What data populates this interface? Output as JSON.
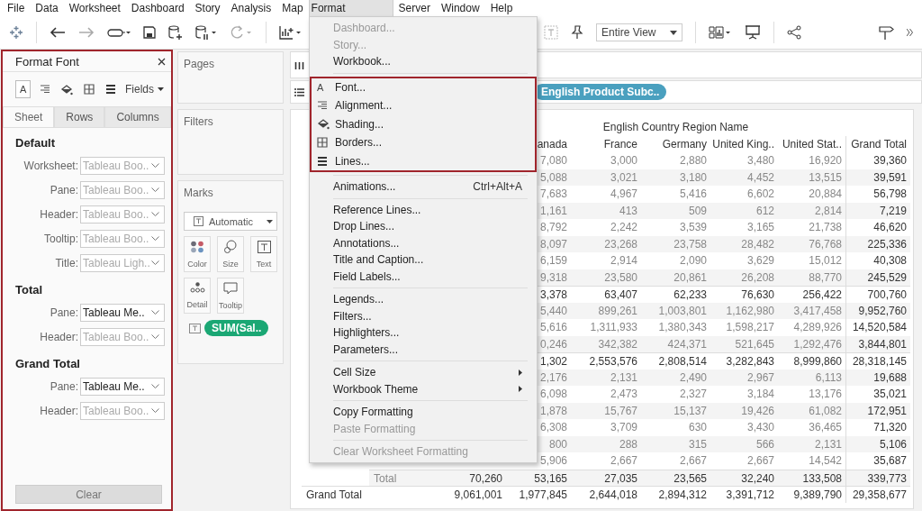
{
  "menu_bar": [
    {
      "label": "File",
      "selected": false
    },
    {
      "label": "Data",
      "selected": false
    },
    {
      "label": "Worksheet",
      "selected": false
    },
    {
      "label": "Dashboard",
      "selected": false
    },
    {
      "label": "Story",
      "selected": false
    },
    {
      "label": "Analysis",
      "selected": false
    },
    {
      "label": "Map",
      "selected": false
    },
    {
      "label": "Format",
      "selected": true
    },
    {
      "label": "Server",
      "selected": false
    },
    {
      "label": "Window",
      "selected": false
    },
    {
      "label": "Help",
      "selected": false
    }
  ],
  "toolbar": {
    "view_dropdown": "Entire View"
  },
  "format_panel": {
    "title": "Format Font",
    "icon_tabs": [
      {
        "kind": "font",
        "glyph": "A",
        "selected": true
      },
      {
        "kind": "alignment",
        "selected": false
      },
      {
        "kind": "shading",
        "selected": false
      },
      {
        "kind": "borders",
        "selected": false
      },
      {
        "kind": "lines",
        "selected": false
      }
    ],
    "fields_menu": "Fields",
    "tabs": [
      {
        "label": "Sheet",
        "selected": true
      },
      {
        "label": "Rows",
        "selected": false
      },
      {
        "label": "Columns",
        "selected": false
      }
    ],
    "sections": [
      {
        "title": "Default",
        "fields": [
          {
            "label": "Worksheet:",
            "value": "Tableau Boo..",
            "dimmed": true
          },
          {
            "label": "Pane:",
            "value": "Tableau Boo..",
            "dimmed": true
          },
          {
            "label": "Header:",
            "value": "Tableau Boo..",
            "dimmed": true
          },
          {
            "label": "Tooltip:",
            "value": "Tableau Boo..",
            "dimmed": true
          },
          {
            "label": "Title:",
            "value": "Tableau Ligh..",
            "dimmed": true
          }
        ]
      },
      {
        "title": "Total",
        "fields": [
          {
            "label": "Pane:",
            "value": "Tableau Me..",
            "dimmed": false
          },
          {
            "label": "Header:",
            "value": "Tableau Boo..",
            "dimmed": true
          }
        ]
      },
      {
        "title": "Grand Total",
        "fields": [
          {
            "label": "Pane:",
            "value": "Tableau Me..",
            "dimmed": false
          },
          {
            "label": "Header:",
            "value": "Tableau Boo..",
            "dimmed": true
          }
        ]
      }
    ],
    "clear_button": {
      "label": "Clear",
      "disabled": true
    }
  },
  "cards": {
    "pages": "Pages",
    "filters": "Filters",
    "marks": {
      "title": "Marks",
      "mark_type": "Automatic",
      "buttons": [
        {
          "kind": "color",
          "label": "Color"
        },
        {
          "kind": "size",
          "label": "Size"
        },
        {
          "kind": "text",
          "label": "Text"
        },
        {
          "kind": "detail",
          "label": "Detail"
        },
        {
          "kind": "tooltip",
          "label": "Tooltip"
        }
      ],
      "pill": "SUM(Sal.."
    }
  },
  "shelves": {
    "rows_pill": "English Product Subc.."
  },
  "table": {
    "group_header": "English Country Region Name",
    "columns": [
      null,
      "anada",
      "France",
      "Germany",
      "United King..",
      "United Stat..",
      "Grand Total"
    ],
    "rows": [
      {
        "kind": "detail",
        "cells": [
          null,
          "7,080",
          "3,000",
          "2,880",
          "3,480",
          "16,920",
          "39,360"
        ]
      },
      {
        "kind": "detail",
        "cells": [
          null,
          "5,088",
          "3,021",
          "3,180",
          "4,452",
          "13,515",
          "39,591"
        ]
      },
      {
        "kind": "detail",
        "cells": [
          null,
          "7,683",
          "4,967",
          "5,416",
          "6,602",
          "20,884",
          "56,798"
        ]
      },
      {
        "kind": "detail",
        "cells": [
          null,
          "1,161",
          "413",
          "509",
          "612",
          "2,814",
          "7,219"
        ]
      },
      {
        "kind": "detail",
        "cells": [
          null,
          "8,792",
          "2,242",
          "3,539",
          "3,165",
          "21,738",
          "46,620"
        ]
      },
      {
        "kind": "detail",
        "cells": [
          null,
          "8,097",
          "23,268",
          "23,758",
          "28,482",
          "76,768",
          "225,336"
        ]
      },
      {
        "kind": "detail",
        "cells": [
          null,
          "6,159",
          "2,914",
          "2,090",
          "3,629",
          "15,012",
          "40,308"
        ]
      },
      {
        "kind": "detail",
        "cells": [
          null,
          "9,318",
          "23,580",
          "20,861",
          "26,208",
          "88,770",
          "245,529"
        ]
      },
      {
        "kind": "subtotal",
        "cells": [
          null,
          "3,378",
          "63,407",
          "62,233",
          "76,630",
          "256,422",
          "700,760"
        ]
      },
      {
        "kind": "detail",
        "cells": [
          null,
          "5,440",
          "899,261",
          "1,003,801",
          "1,162,980",
          "3,417,458",
          "9,952,760"
        ]
      },
      {
        "kind": "detail",
        "cells": [
          null,
          "5,616",
          "1,311,933",
          "1,380,343",
          "1,598,217",
          "4,289,926",
          "14,520,584"
        ]
      },
      {
        "kind": "detail",
        "cells": [
          null,
          "0,246",
          "342,382",
          "424,371",
          "521,645",
          "1,292,476",
          "3,844,801"
        ]
      },
      {
        "kind": "subtotal",
        "cells": [
          null,
          "1,302",
          "2,553,576",
          "2,808,514",
          "3,282,843",
          "8,999,860",
          "28,318,145"
        ]
      },
      {
        "kind": "detail",
        "cells": [
          null,
          "2,176",
          "2,131",
          "2,490",
          "2,967",
          "6,113",
          "19,688"
        ]
      },
      {
        "kind": "detail",
        "cells": [
          null,
          "6,098",
          "2,473",
          "2,327",
          "3,184",
          "13,176",
          "35,021"
        ]
      },
      {
        "kind": "detail",
        "cells": [
          null,
          "1,878",
          "15,767",
          "15,137",
          "19,426",
          "61,082",
          "172,951"
        ]
      },
      {
        "kind": "detail",
        "cells": [
          null,
          "6,308",
          "3,709",
          "630",
          "3,430",
          "36,465",
          "71,320"
        ]
      },
      {
        "kind": "detail",
        "cells": [
          null,
          "800",
          "288",
          "315",
          "566",
          "2,131",
          "5,106"
        ]
      },
      {
        "kind": "detail",
        "cells": [
          null,
          "5,906",
          "2,667",
          "2,667",
          "2,667",
          "14,542",
          "35,687"
        ]
      },
      {
        "kind": "subtotal",
        "label": "Total",
        "cells": [
          "70,260",
          "53,165",
          "27,035",
          "23,565",
          "32,240",
          "133,508",
          "339,773"
        ]
      },
      {
        "kind": "grand",
        "label": "Grand Total",
        "cells": [
          "9,061,001",
          "1,977,845",
          "2,644,018",
          "2,894,312",
          "3,391,712",
          "9,389,790",
          "29,358,677"
        ]
      }
    ]
  },
  "format_menu": {
    "sections": [
      {
        "highlighted": false,
        "items": [
          {
            "kind": "plain",
            "label": "Dashboard...",
            "disabled": true
          },
          {
            "kind": "plain",
            "label": "Story...",
            "disabled": true
          },
          {
            "kind": "plain",
            "label": "Workbook...",
            "disabled": false
          }
        ]
      },
      {
        "highlighted": true,
        "items": [
          {
            "kind": "font",
            "glyph": "A",
            "label": "Font...",
            "disabled": false
          },
          {
            "kind": "alignment",
            "label": "Alignment...",
            "disabled": false
          },
          {
            "kind": "shading",
            "label": "Shading...",
            "disabled": false
          },
          {
            "kind": "borders",
            "label": "Borders...",
            "disabled": false
          },
          {
            "kind": "lines",
            "label": "Lines...",
            "disabled": false
          }
        ]
      },
      {
        "highlighted": false,
        "items": [
          {
            "kind": "plain",
            "label": "Animations...",
            "shortcut": "Ctrl+Alt+A",
            "disabled": false
          }
        ]
      },
      {
        "highlighted": false,
        "items": [
          {
            "kind": "plain",
            "label": "Reference Lines...",
            "disabled": false
          },
          {
            "kind": "plain",
            "label": "Drop Lines...",
            "disabled": false
          },
          {
            "kind": "plain",
            "label": "Annotations...",
            "disabled": false
          },
          {
            "kind": "plain",
            "label": "Title and Caption...",
            "disabled": false
          },
          {
            "kind": "plain",
            "label": "Field Labels...",
            "disabled": false
          }
        ]
      },
      {
        "highlighted": false,
        "items": [
          {
            "kind": "plain",
            "label": "Legends...",
            "disabled": false
          },
          {
            "kind": "plain",
            "label": "Filters...",
            "disabled": false
          },
          {
            "kind": "plain",
            "label": "Highlighters...",
            "disabled": false
          },
          {
            "kind": "plain",
            "label": "Parameters...",
            "disabled": false
          }
        ]
      },
      {
        "highlighted": false,
        "items": [
          {
            "kind": "submenu",
            "label": "Cell Size",
            "disabled": false
          },
          {
            "kind": "submenu",
            "label": "Workbook Theme",
            "disabled": false
          }
        ]
      },
      {
        "highlighted": false,
        "items": [
          {
            "kind": "plain",
            "label": "Copy Formatting",
            "disabled": false
          },
          {
            "kind": "plain",
            "label": "Paste Formatting",
            "disabled": true
          }
        ]
      },
      {
        "highlighted": false,
        "items": [
          {
            "kind": "plain",
            "label": "Clear Worksheet Formatting",
            "disabled": true
          }
        ]
      }
    ]
  }
}
